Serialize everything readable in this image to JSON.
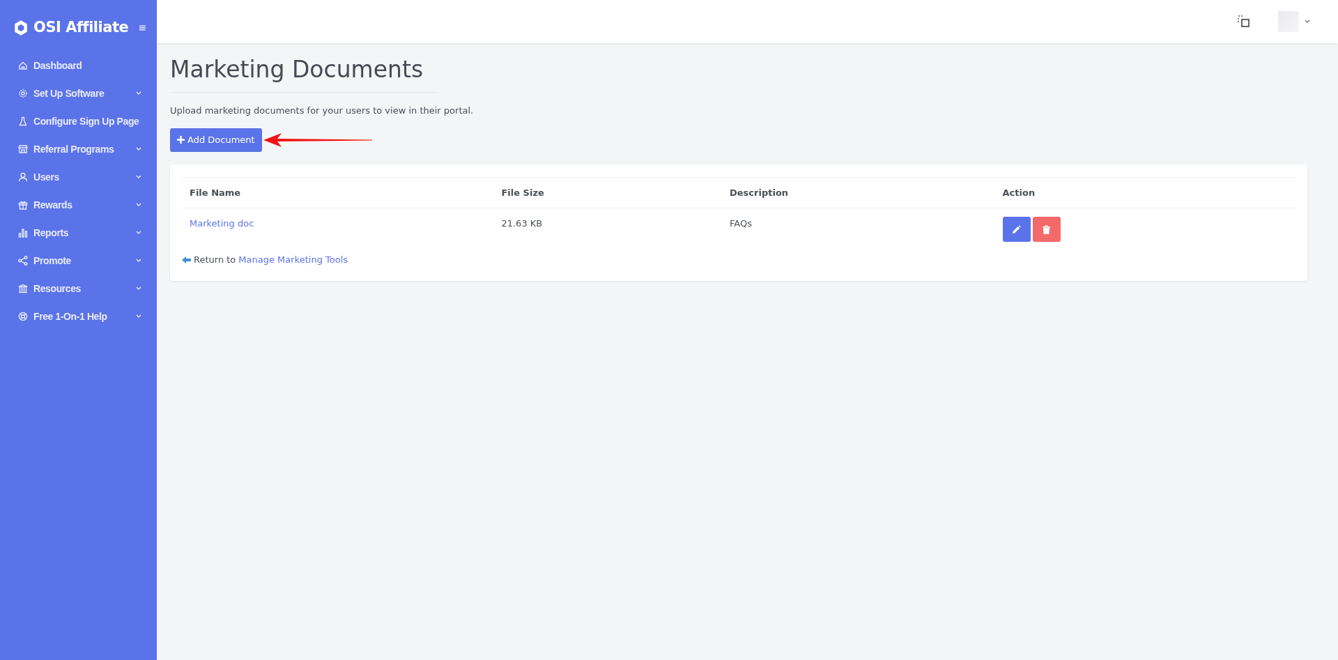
{
  "brand": {
    "name": "OSI Affiliate"
  },
  "sidebar": {
    "items": [
      {
        "label": "Dashboard",
        "expandable": false
      },
      {
        "label": "Set Up Software",
        "expandable": true
      },
      {
        "label": "Configure Sign Up Page",
        "expandable": false
      },
      {
        "label": "Referral Programs",
        "expandable": true
      },
      {
        "label": "Users",
        "expandable": true
      },
      {
        "label": "Rewards",
        "expandable": true
      },
      {
        "label": "Reports",
        "expandable": true
      },
      {
        "label": "Promote",
        "expandable": true
      },
      {
        "label": "Resources",
        "expandable": true
      },
      {
        "label": "Free 1-On-1 Help",
        "expandable": true
      }
    ]
  },
  "page": {
    "title": "Marketing Documents",
    "description": "Upload marketing documents for your users to view in their portal.",
    "add_button": "Add Document"
  },
  "table": {
    "columns": [
      "File Name",
      "File Size",
      "Description",
      "Action"
    ],
    "rows": [
      {
        "file_name": "Marketing doc",
        "file_size": "21.63 KB",
        "description": "FAQs"
      }
    ]
  },
  "return_link": {
    "prefix": "Return to",
    "link": "Manage Marketing Tools"
  }
}
